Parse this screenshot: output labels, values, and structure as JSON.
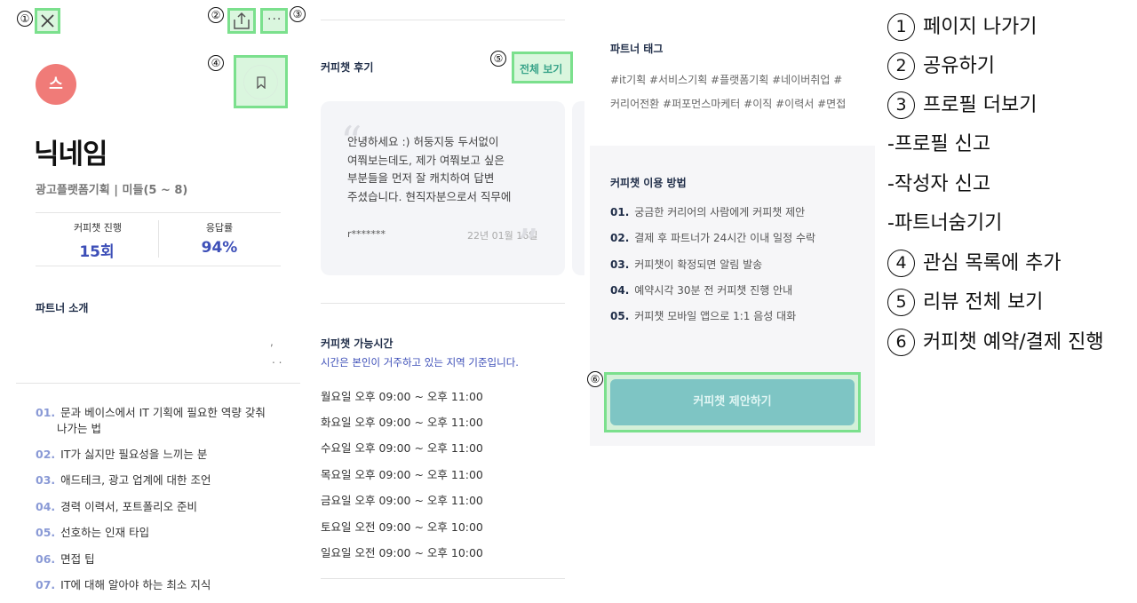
{
  "panel1": {
    "avatar_letter": "스",
    "nickname": "닉네임",
    "subinfo": "광고플랫폼기획 | 미들(5 ~ 8)",
    "stats": [
      {
        "label": "커피챗 진행",
        "value": "15회"
      },
      {
        "label": "응답률",
        "value": "94%"
      }
    ],
    "intro_title": "파트너 소개",
    "intro_marks": [
      ",",
      ". ."
    ],
    "topics": [
      {
        "num": "01.",
        "text": "문과 베이스에서 IT 기획에 필요한 역량 갖춰",
        "cont": "나가는 법"
      },
      {
        "num": "02.",
        "text": "IT가 싫지만 필요성을 느끼는 분"
      },
      {
        "num": "03.",
        "text": "애드테크, 광고 업계에 대한 조언"
      },
      {
        "num": "04.",
        "text": "경력 이력서, 포트폴리오 준비"
      },
      {
        "num": "05.",
        "text": "선호하는 인재 타입"
      },
      {
        "num": "06.",
        "text": "면접 팁"
      },
      {
        "num": "07.",
        "text": "IT에 대해 알아야 하는 최소 지식"
      }
    ]
  },
  "markers": [
    "①",
    "②",
    "③",
    "④",
    "⑤",
    "⑥"
  ],
  "panel2": {
    "review_title": "커피챗 후기",
    "view_all": "전체 보기",
    "open_quote": "“",
    "close_quote": "”",
    "review_lines": [
      "안녕하세요 :) 허둥지둥 두서없이",
      "여쭤보는데도, 제가 여쭤보고 싶은",
      "부분들을 먼저 잘 캐치하여 답변",
      "주셨습니다. 현직자분으로서 직무에"
    ],
    "reviewer": "r*******",
    "review_date": "22년 01월 16일",
    "hours_title": "커피챗 가능시간",
    "hours_note": "시간은 본인이 거주하고 있는 지역 기준입니다.",
    "schedule": [
      "월요일 오후 09:00 ~ 오후 11:00",
      "화요일 오후 09:00 ~ 오후 11:00",
      "수요일 오후 09:00 ~ 오후 11:00",
      "목요일 오후 09:00 ~ 오후 11:00",
      "금요일 오후 09:00 ~ 오후 11:00",
      "토요일 오전 09:00 ~ 오후 10:00",
      "일요일 오전 09:00 ~ 오후 10:00"
    ]
  },
  "panel3": {
    "tag_title": "파트너 태그",
    "tag_lines": [
      "#it기획 #서비스기획 #플랫폼기획 #네이버취업 #",
      "커리어전환 #퍼포먼스마케터 #이직 #이력서 #면접"
    ],
    "usage_title": "커피챗 이용 방법",
    "steps": [
      {
        "num": "01.",
        "text": "궁금한 커리어의 사람에게 커피챗 제안"
      },
      {
        "num": "02.",
        "text": "결제 후 파트너가 24시간 이내 일정 수락"
      },
      {
        "num": "03.",
        "text": "커피챗이 확정되면 알림 발송"
      },
      {
        "num": "04.",
        "text": "예약시각 30분 전 커피챗 진행 안내"
      },
      {
        "num": "05.",
        "text": "커피챗 모바일 앱으로 1:1 음성 대화"
      }
    ],
    "cta_label": "커피챗 제안하기"
  },
  "legend": [
    {
      "marker": "1",
      "text": "페이지 나가기"
    },
    {
      "marker": "2",
      "text": "공유하기"
    },
    {
      "marker": "3",
      "text": "프로필 더보기"
    },
    {
      "marker": "",
      "text": "-프로필 신고"
    },
    {
      "marker": "",
      "text": "-작성자 신고"
    },
    {
      "marker": "",
      "text": "-파트너숨기기"
    },
    {
      "marker": "4",
      "text": "관심 목록에 추가"
    },
    {
      "marker": "5",
      "text": "리뷰 전체 보기"
    },
    {
      "marker": "6",
      "text": "커피챗 예약/결제 진행"
    }
  ],
  "colors": {
    "highlight": "#7be08d",
    "accent_blue": "#3d4fb8",
    "cta": "#7ec5c4",
    "avatar": "#f07b78"
  }
}
